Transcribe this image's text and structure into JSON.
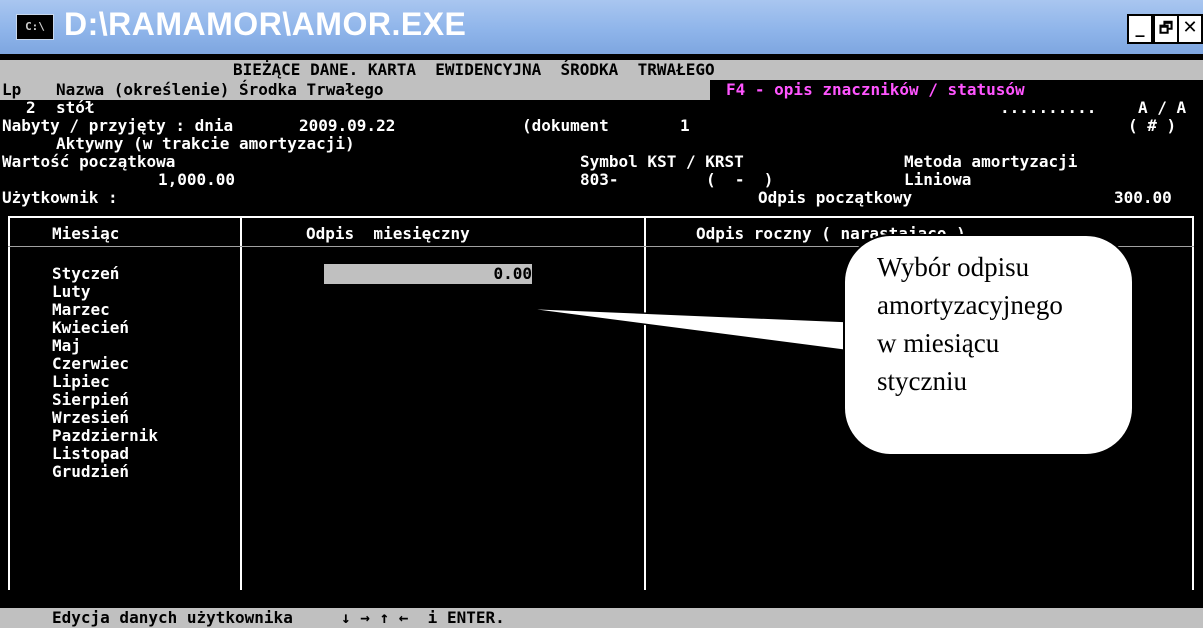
{
  "window": {
    "title": "D:\\RAMAMOR\\AMOR.EXE",
    "icon_label": "C:\\",
    "minimize": "_",
    "restore": "🗗",
    "close": "✕"
  },
  "header": {
    "title_line": "BIEŻĄCE DANE. KARTA  EWIDENCYJNA  ŚRODKA  TRWAŁEGO",
    "lp_label": "Lp",
    "name_label": "Nazwa (określenie) Środka Trwałego",
    "f4_hint": "F4 - opis znaczników / statusów",
    "lp_value": "2",
    "name_value": "stół",
    "dots": "..........",
    "status_flags": "A / A",
    "status_marker": "( # )",
    "acquired_label": "Nabyty / przyjęty : dnia",
    "acquired_date": "2009.09.22",
    "document_label": "(dokument",
    "document_value": "1",
    "state": "Aktywny (w trakcie amortyzacji)",
    "initial_value_label": "Wartość początkowa",
    "initial_value": "1,000.00",
    "symbol_label": "Symbol KST / KRST",
    "symbol_value": "803-",
    "krst_value": "(  -  )",
    "method_label": "Metoda amortyzacji",
    "method_value": "Liniowa",
    "user_label": "Użytkownik :",
    "initial_writeoff_label": "Odpis początkowy",
    "initial_writeoff_value": "300.00"
  },
  "table": {
    "col_month": "Miesiąc",
    "col_monthly": "Odpis  miesięczny",
    "col_yearly": "Odpis roczny ( narastająco )",
    "months": [
      "Styczeń",
      "Luty",
      "Marzec",
      "Kwiecień",
      "Maj",
      "Czerwiec",
      "Lipiec",
      "Sierpień",
      "Wrzesień",
      "Pazdziernik",
      "Listopad",
      "Grudzień"
    ],
    "selected_monthly_value": "0.00"
  },
  "callout": {
    "text": "Wybór odpisu\namortyzacyjnego\nw miesiącu\nstyczniu"
  },
  "status_bar": {
    "text": "Edycja danych użytkownika     ↓ → ↑ ←  i ENTER."
  }
}
